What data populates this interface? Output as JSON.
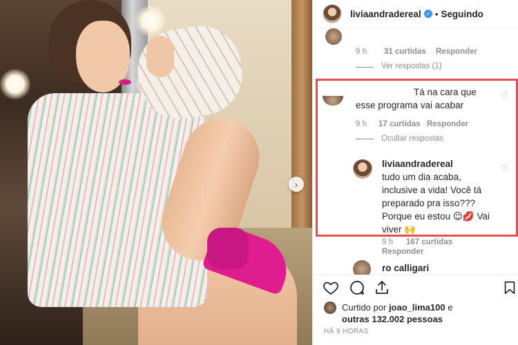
{
  "post": {
    "username": "liviaandradereal",
    "verified_mark": "✓",
    "dot": "•",
    "follow_label": "Seguindo"
  },
  "comments": {
    "c1": {
      "time": "9 h",
      "likes": "31 curtidas",
      "reply": "Responder",
      "replies_link": "Ver respostas (1)"
    },
    "c2": {
      "text": "Tá na cara que esse programa vai acabar",
      "time": "9 h",
      "likes": "17 curtidas",
      "reply": "Responder",
      "replies_link": "Ocultar respostas"
    },
    "c3": {
      "username": "liviaandradereal",
      "text": "tudo um dia acaba, inclusive a vida! Você tá preparado pra isso??? Porque eu estou 😉💋 Vai viver 🙌"
    },
    "c4": {
      "time": "9 h",
      "likes": "167 curtidas",
      "reply": "Responder"
    },
    "c5": {
      "username": "ro calligari"
    }
  },
  "actions": {
    "liked_prefix": "Curtido por",
    "liked_user": "joao_lima100",
    "liked_conj": "e",
    "liked_others": "outras 132.002 pessoas",
    "time_ago": "HÁ 9 HORAS"
  },
  "icons": {
    "heart": "heart-icon",
    "comment": "comment-icon",
    "share": "share-icon",
    "bookmark": "bookmark-icon",
    "next": "chevron-right-icon"
  },
  "colors": {
    "highlight": "#e94b53",
    "verified": "#3897f0",
    "muted": "#8e8e8e"
  }
}
